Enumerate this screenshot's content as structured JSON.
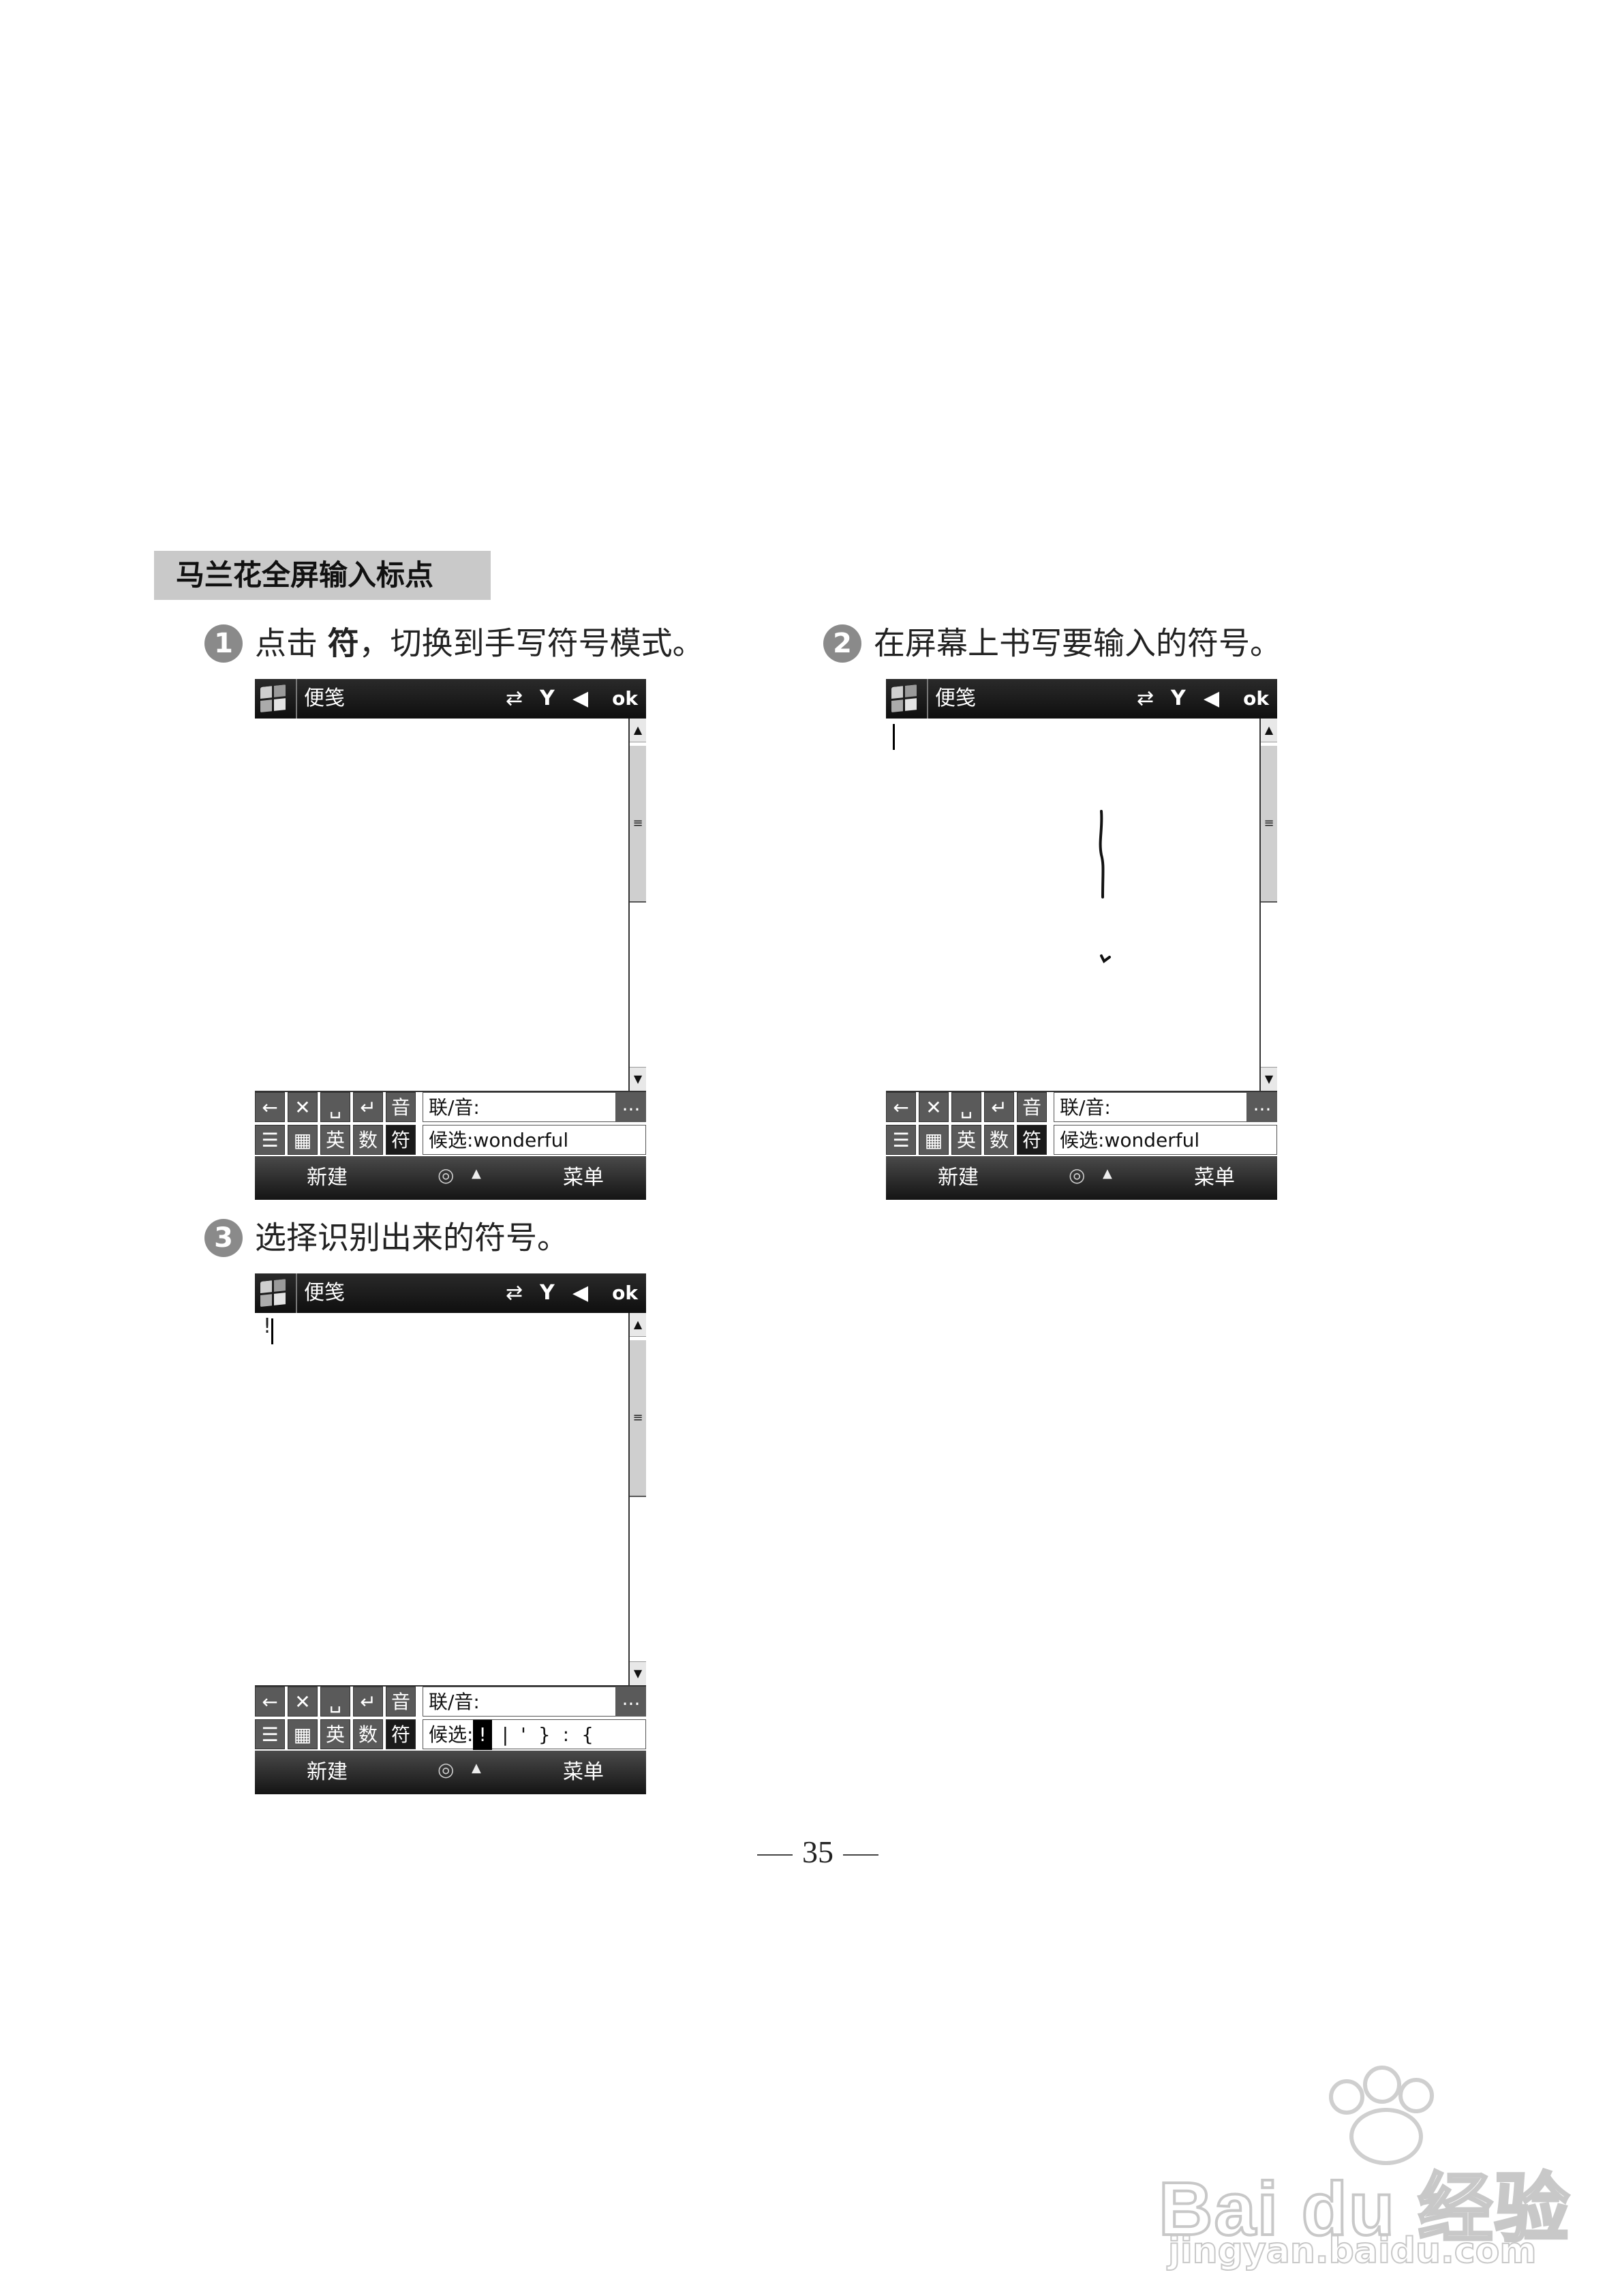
{
  "section_title": "马兰花全屏输入标点",
  "steps": [
    {
      "num": "1",
      "text_before": "点击 ",
      "text_bold": "符",
      "text_after": "，切换到手写符号模式。"
    },
    {
      "num": "2",
      "text": "在屏幕上书写要输入的符号。"
    },
    {
      "num": "3",
      "text": "选择识别出来的符号。"
    }
  ],
  "device": {
    "app_title": "便笺",
    "status_icons": [
      "sync-arrows-icon",
      "signal-icon",
      "speaker-icon"
    ],
    "status_glyphs": {
      "sync": "⇄",
      "signal": "Y",
      "speaker": "◀"
    },
    "ok_label": "ok",
    "scroll_up": "▲",
    "scroll_down": "▼",
    "scroll_grip": "≡",
    "ime_row1_keys": [
      "←",
      "✕",
      "␣",
      "↵",
      "音"
    ],
    "ime_row2_keys": [
      "☰",
      "▦",
      "英",
      "数",
      "符"
    ],
    "lianyin_label": "联/音:",
    "more_label": "...",
    "candidate_label": "候选:",
    "candidate_word": "wonderful",
    "softkey_left": "新建",
    "softkey_mid": "◎",
    "softkey_up": "▲",
    "softkey_right": "菜单"
  },
  "screen3": {
    "typed_text": "!",
    "candidates": [
      "!",
      "|",
      "'",
      "}",
      ":",
      "{"
    ]
  },
  "page_number": "35",
  "watermark": {
    "brand": "Bai du 经验",
    "url": "jingyan.baidu.com"
  }
}
